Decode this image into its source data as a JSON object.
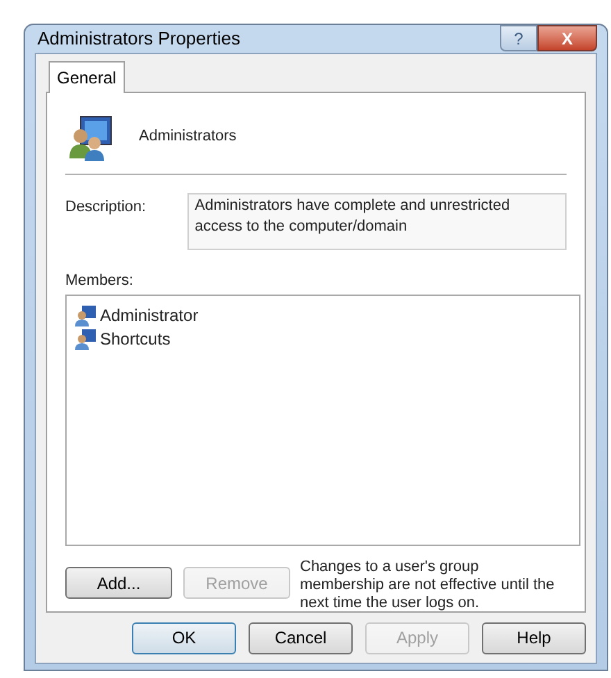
{
  "window": {
    "title": "Administrators Properties",
    "title_buttons": [
      {
        "kind": "help",
        "label": "?"
      },
      {
        "kind": "close",
        "label": "X"
      }
    ]
  },
  "tabs": [
    {
      "label": "General",
      "selected": true
    }
  ],
  "group": {
    "name": "Administrators"
  },
  "description": {
    "label": "Description:",
    "value": "Administrators have complete and unrestricted access to the computer/domain"
  },
  "members": {
    "label": "Members:",
    "items": [
      {
        "name": "Administrator"
      },
      {
        "name": "Shortcuts"
      }
    ]
  },
  "member_buttons": [
    {
      "label": "Add...",
      "disabled": false
    },
    {
      "label": "Remove",
      "disabled": true
    }
  ],
  "note": "Changes to a user's group membership are not effective until the next time the user logs on.",
  "buttons": [
    {
      "label": "OK",
      "disabled": false,
      "default": true
    },
    {
      "label": "Cancel",
      "disabled": false,
      "default": false
    },
    {
      "label": "Apply",
      "disabled": true,
      "default": false
    },
    {
      "label": "Help",
      "disabled": false,
      "default": false
    }
  ]
}
